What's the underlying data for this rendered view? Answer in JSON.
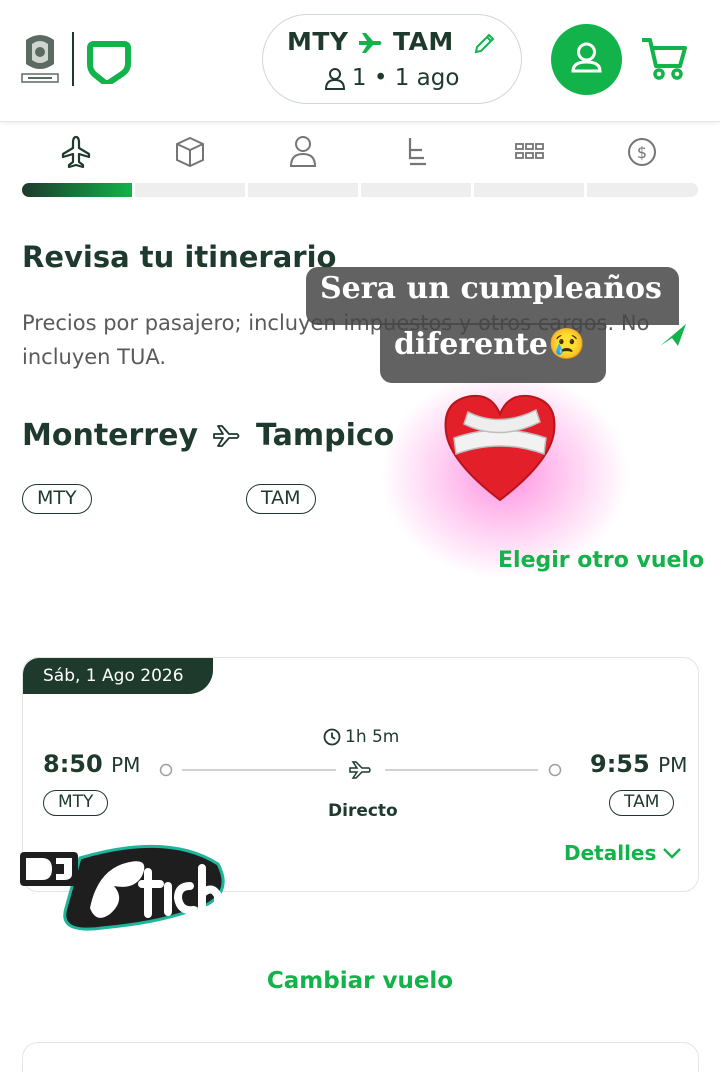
{
  "header": {
    "route": {
      "origin": "MTY",
      "destination": "TAM"
    },
    "passengers": "1",
    "date_short": "1 ago",
    "separator": "•"
  },
  "steps": [
    "flight-icon",
    "baggage-icon",
    "passenger-icon",
    "seat-icon",
    "extras-icon",
    "payment-icon"
  ],
  "progress": {
    "current_step": 1,
    "total_steps": 6
  },
  "itinerary": {
    "title": "Revisa tu itinerario",
    "subtitle": "Precios por pasajero; incluyen impuestos y otros cargos. No incluyen TUA.",
    "origin_city": "Monterrey",
    "destination_city": "Tampico",
    "origin_code": "MTY",
    "destination_code": "TAM",
    "change_flight_link": "Elegir otro vuelo"
  },
  "overlay": {
    "line1": "Sera un cumpleaños",
    "line2": "diferente😢"
  },
  "flight_card": {
    "date": "Sáb, 1 Ago 2026",
    "departure_time": "8:50",
    "departure_ampm": "PM",
    "arrival_time": "9:55",
    "arrival_ampm": "PM",
    "origin_code": "MTY",
    "destination_code": "TAM",
    "duration": "1h 5m",
    "stops": "Directo",
    "details_link": "Detalles"
  },
  "footer": {
    "change_flight": "Cambiar vuelo"
  },
  "colors": {
    "primary_green": "#12b34a",
    "dark_green": "#1e3a2c"
  }
}
